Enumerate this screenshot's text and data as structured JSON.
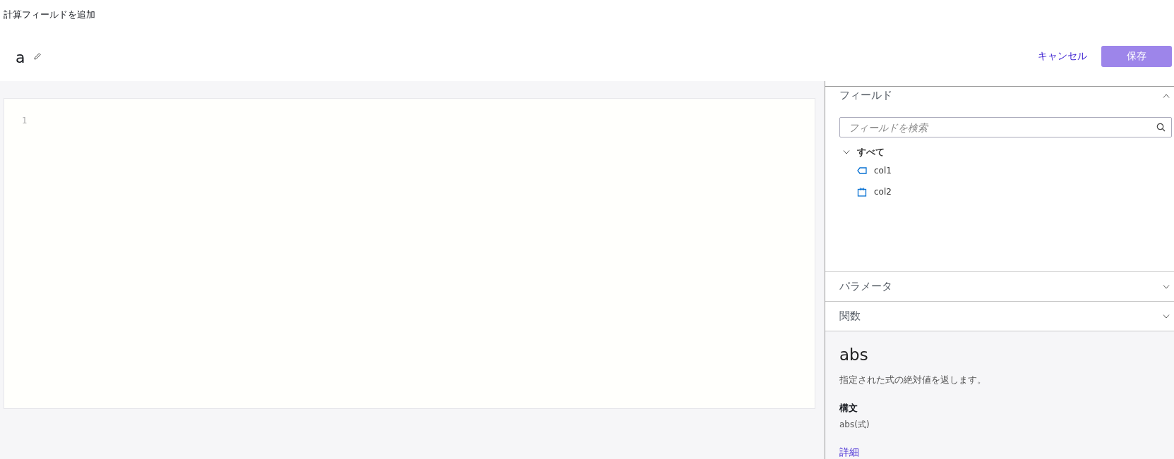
{
  "window": {
    "title": "計算フィールドを追加"
  },
  "field_name": "a",
  "buttons": {
    "cancel": "キャンセル",
    "save": {
      "label": "保存",
      "disabled": true
    }
  },
  "editor": {
    "line_numbers": [
      "1"
    ]
  },
  "sidebar": {
    "sections": [
      {
        "title": "フィールド",
        "expanded": true,
        "search": {
          "placeholder": "フィールドを検索"
        },
        "tree": [
          {
            "label": "すべて",
            "expanded": true,
            "children": [
              {
                "label": "col1",
                "kind": "text"
              },
              {
                "label": "col2",
                "kind": "date"
              }
            ]
          }
        ]
      },
      {
        "title": "パラメータ",
        "expanded": false
      },
      {
        "title": "関数",
        "expanded": false
      }
    ],
    "function_help": {
      "name": "abs",
      "description": "指定された式の絶対値を返します。",
      "syntax_heading": "構文",
      "syntax": "abs(式)",
      "link": "詳細"
    }
  }
}
